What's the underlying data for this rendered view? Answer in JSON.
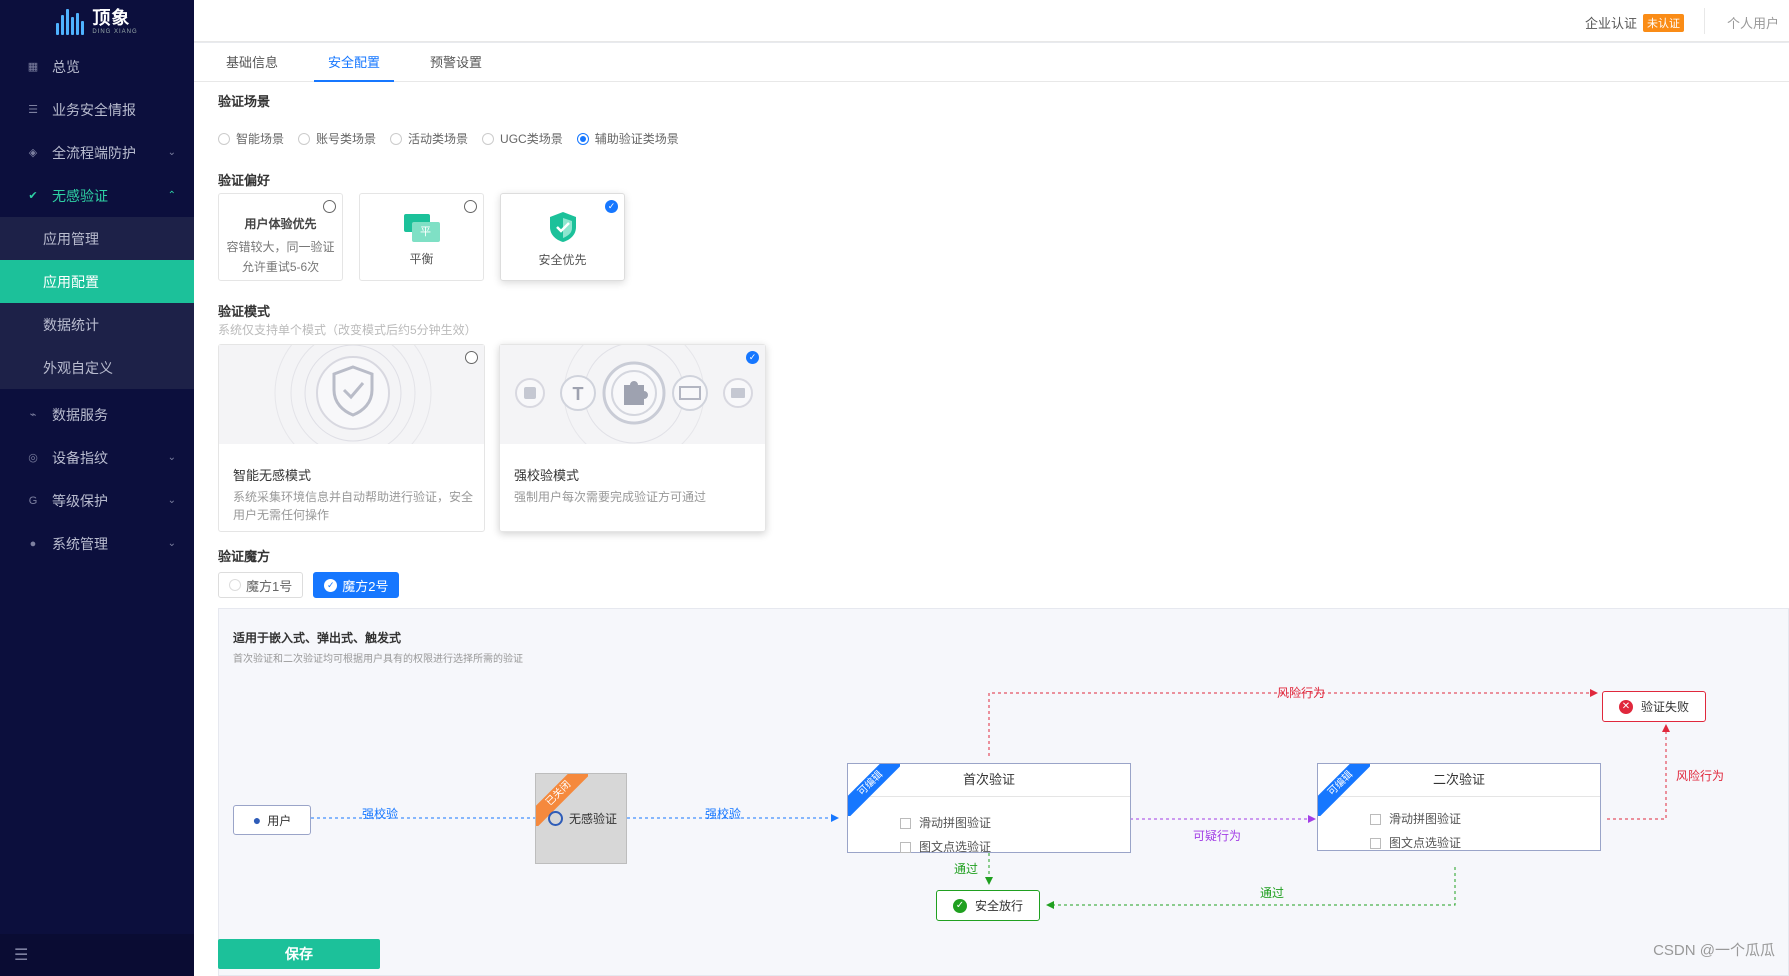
{
  "brand": {
    "name": "顶象",
    "sub": "DING XIANG"
  },
  "sidebar": {
    "items": [
      {
        "label": "总览"
      },
      {
        "label": "业务安全情报"
      },
      {
        "label": "全流程端防护"
      },
      {
        "label": "无感验证"
      }
    ],
    "sub_items": [
      {
        "label": "应用管理"
      },
      {
        "label": "应用配置"
      },
      {
        "label": "数据统计"
      },
      {
        "label": "外观自定义"
      }
    ],
    "items2": [
      {
        "label": "数据服务"
      },
      {
        "label": "设备指纹"
      },
      {
        "label": "等级保护"
      },
      {
        "label": "系统管理"
      }
    ]
  },
  "topbar": {
    "cert": "企业认证",
    "cert_badge": "未认证",
    "user": "个人用户"
  },
  "tabs": [
    {
      "label": "基础信息"
    },
    {
      "label": "安全配置"
    },
    {
      "label": "预警设置"
    }
  ],
  "scene": {
    "title": "验证场景",
    "options": [
      "智能场景",
      "账号类场景",
      "活动类场景",
      "UGC类场景",
      "辅助验证类场景"
    ],
    "selected": "辅助验证类场景"
  },
  "preference": {
    "title": "验证偏好",
    "cards": [
      {
        "title": "用户体验优先",
        "desc1": "容错较大，同一验证",
        "desc2": "允许重试5-6次"
      },
      {
        "title": "平衡",
        "icon_text": "平"
      },
      {
        "title": "安全优先"
      }
    ],
    "selected": "安全优先"
  },
  "mode": {
    "title": "验证模式",
    "hint": "系统仅支持单个模式（改变模式后约5分钟生效）",
    "cards": [
      {
        "name": "智能无感模式",
        "desc": "系统采集环境信息并自动帮助进行验证，安全用户无需任何操作"
      },
      {
        "name": "强校验模式",
        "desc": "强制用户每次需要完成验证方可通过"
      }
    ],
    "selected": "强校验模式"
  },
  "magic": {
    "title": "验证魔方",
    "options": [
      "魔方1号",
      "魔方2号"
    ],
    "selected": "魔方2号"
  },
  "flow": {
    "title": "适用于嵌入式、弹出式、触发式",
    "subtitle": "首次验证和二次验证均可根据用户具有的权限进行选择所需的验证",
    "user": "用户",
    "strong1": "强校验",
    "strong2": "强校验",
    "closed": "已关闭",
    "noninductive": "无感验证",
    "editable": "可编辑",
    "first": {
      "title": "首次验证",
      "items": [
        "滑动拼图验证",
        "图文点选验证"
      ]
    },
    "second": {
      "title": "二次验证",
      "items": [
        "滑动拼图验证",
        "图文点选验证"
      ]
    },
    "suspicious": "可疑行为",
    "risk1": "风险行为",
    "risk2": "风险行为",
    "pass1": "通过",
    "pass2": "通过",
    "fail": "验证失败",
    "release": "安全放行"
  },
  "save_label": "保存",
  "watermark": "CSDN @一个瓜瓜",
  "colors": {
    "accent": "#1cc19a",
    "primary": "#1677ff",
    "sidebar": "#0c0f3d",
    "risk": "#e0283c",
    "suspicious": "#a23ee6",
    "pass": "#20a020",
    "closed": "#f5893d"
  }
}
